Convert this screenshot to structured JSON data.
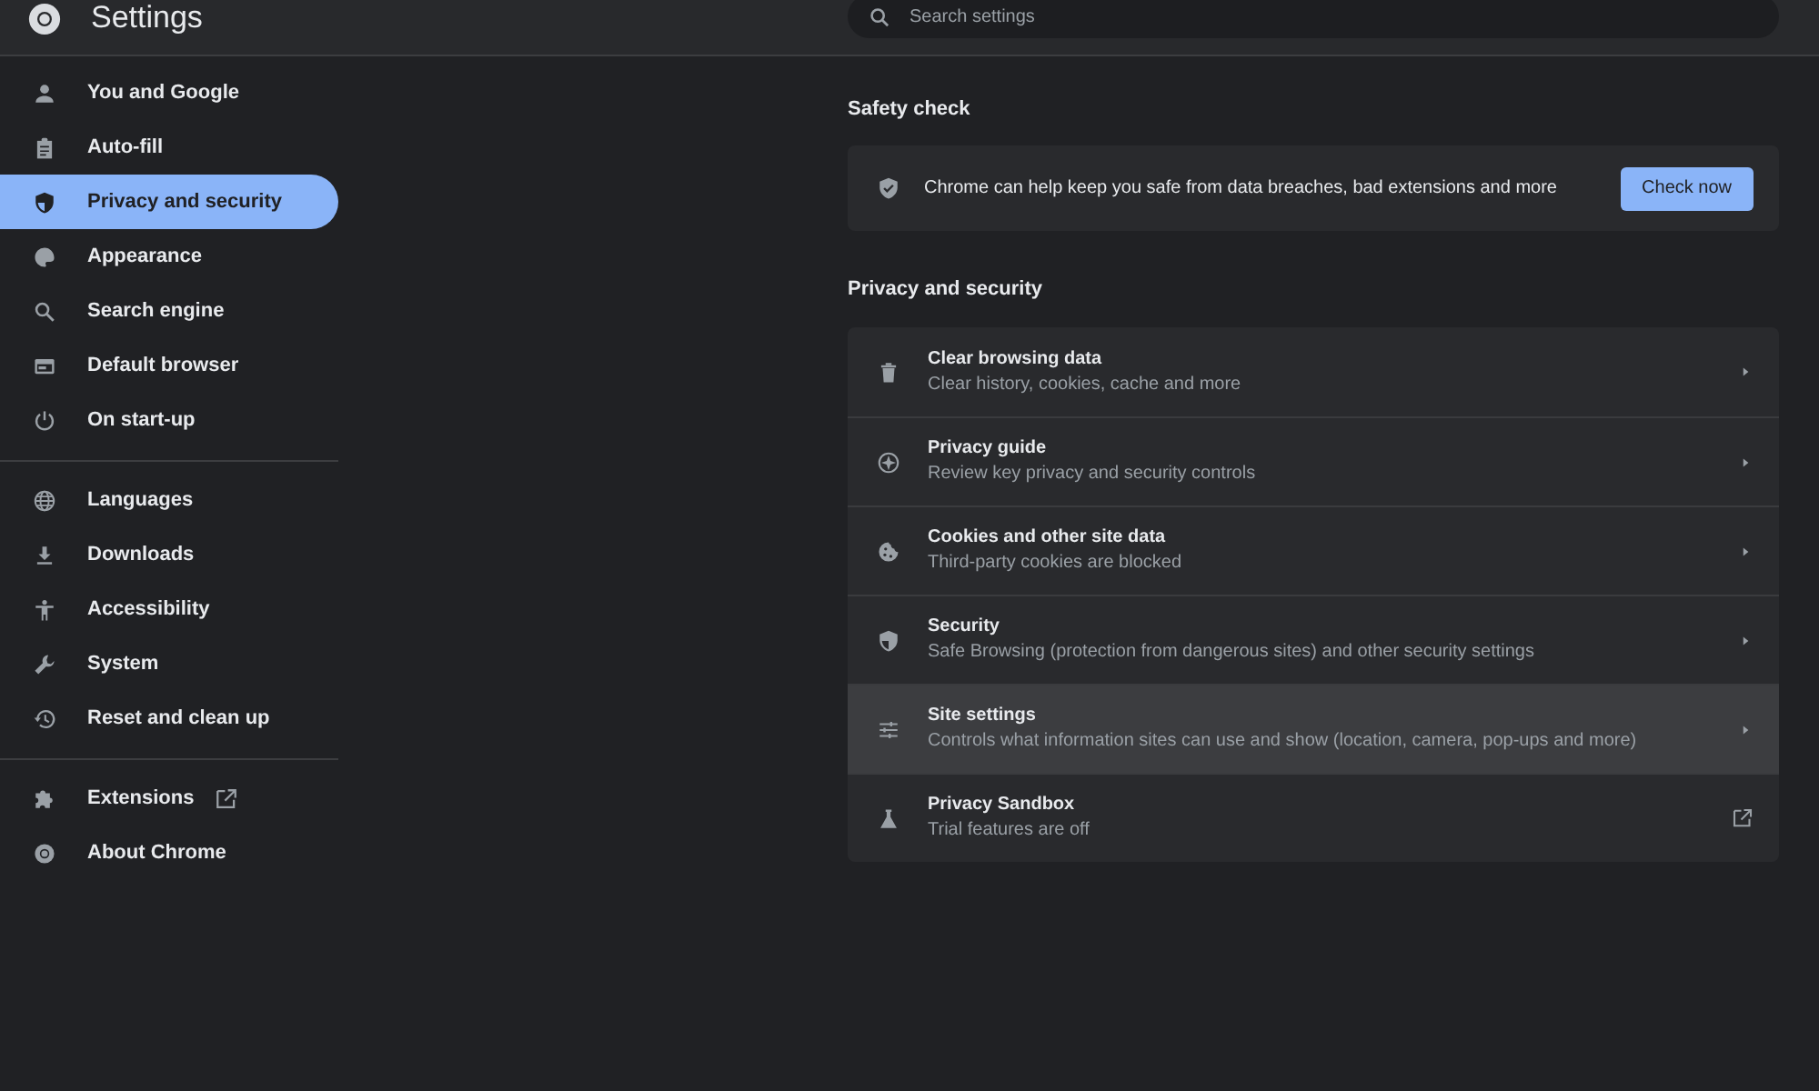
{
  "header": {
    "title": "Settings",
    "search": {
      "placeholder": "Search settings"
    }
  },
  "sidebar": {
    "groups": [
      {
        "items": [
          {
            "label": "You and Google",
            "selected": false
          },
          {
            "label": "Auto-fill",
            "selected": false
          },
          {
            "label": "Privacy and security",
            "selected": true
          },
          {
            "label": "Appearance",
            "selected": false
          },
          {
            "label": "Search engine",
            "selected": false
          },
          {
            "label": "Default browser",
            "selected": false
          },
          {
            "label": "On start-up",
            "selected": false
          }
        ]
      },
      {
        "items": [
          {
            "label": "Languages",
            "selected": false
          },
          {
            "label": "Downloads",
            "selected": false
          },
          {
            "label": "Accessibility",
            "selected": false
          },
          {
            "label": "System",
            "selected": false
          },
          {
            "label": "Reset and clean up",
            "selected": false
          }
        ]
      },
      {
        "items": [
          {
            "label": "Extensions",
            "selected": false,
            "external": true
          },
          {
            "label": "About Chrome",
            "selected": false,
            "external": false
          }
        ]
      }
    ]
  },
  "safety_check": {
    "heading": "Safety check",
    "text": "Chrome can help keep you safe from data breaches, bad extensions and more",
    "button": "Check now"
  },
  "privacy": {
    "heading": "Privacy and security",
    "rows": [
      {
        "kind": "submenu",
        "title": "Clear browsing data",
        "subtitle": "Clear history, cookies, cache and more",
        "hovered": false
      },
      {
        "kind": "submenu",
        "title": "Privacy guide",
        "subtitle": "Review key privacy and security controls",
        "hovered": false
      },
      {
        "kind": "submenu",
        "title": "Cookies and other site data",
        "subtitle": "Third-party cookies are blocked",
        "hovered": false
      },
      {
        "kind": "submenu",
        "title": "Security",
        "subtitle": "Safe Browsing (protection from dangerous sites) and other security settings",
        "hovered": false
      },
      {
        "kind": "submenu",
        "title": "Site settings",
        "subtitle": "Controls what information sites can use and show (location, camera, pop-ups and more)",
        "hovered": true
      },
      {
        "kind": "external",
        "title": "Privacy Sandbox",
        "subtitle": "Trial features are off",
        "hovered": false
      }
    ]
  }
}
